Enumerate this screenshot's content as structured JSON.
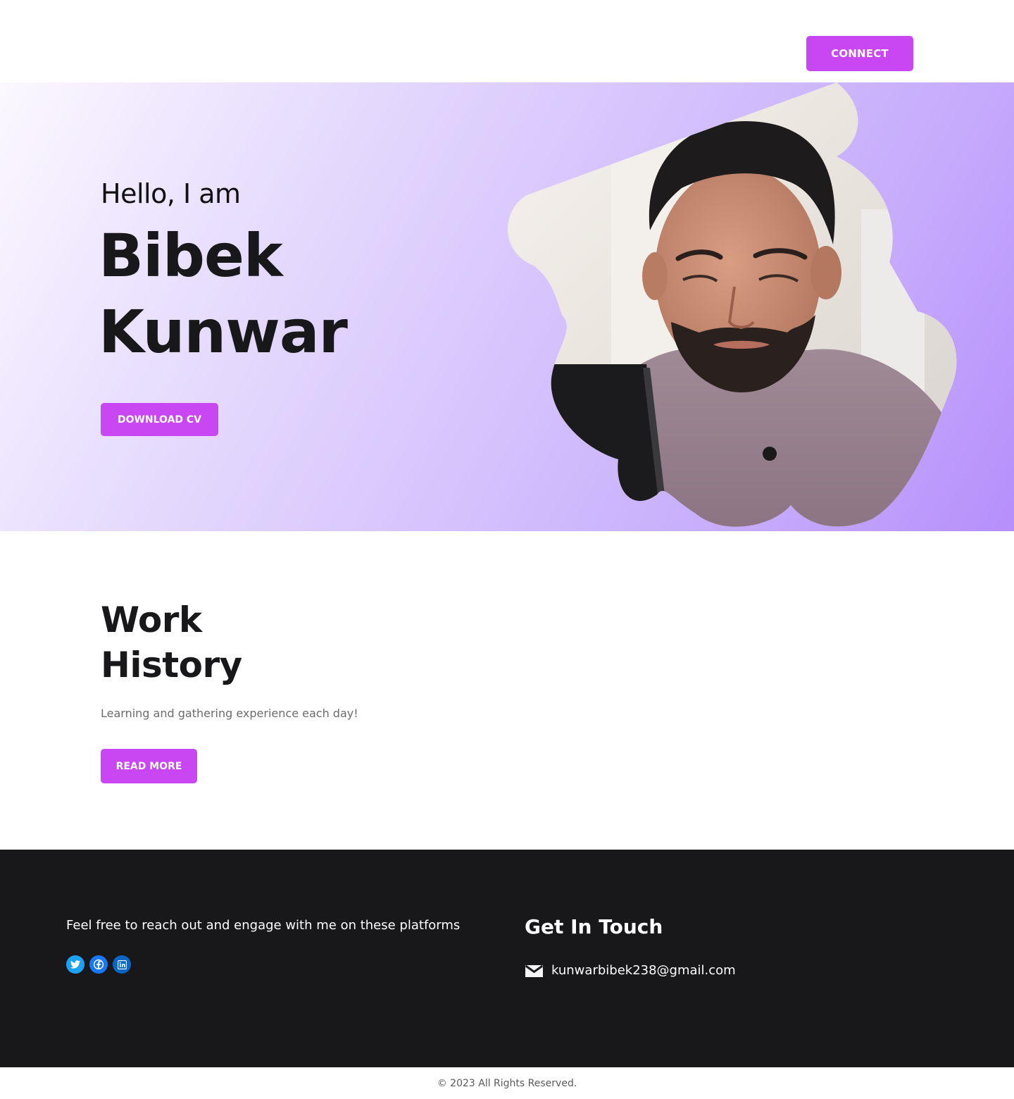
{
  "header": {
    "connect_label": "CONNECT"
  },
  "hero": {
    "greeting": "Hello, I am",
    "name_first": "Bibek",
    "name_last": "Kunwar",
    "download_label": "DOWNLOAD CV",
    "photo_icon": "portrait-photo"
  },
  "work": {
    "title_line1": "Work",
    "title_line2": "History",
    "subtitle": "Learning and gathering experience each day!",
    "read_more_label": "READ MORE"
  },
  "footer": {
    "tagline": "Feel free to reach out and engage with me on these platforms",
    "socials": [
      {
        "icon": "twitter-icon",
        "color": "#1da1f2"
      },
      {
        "icon": "facebook-icon",
        "color": "#1877f2"
      },
      {
        "icon": "linkedin-icon",
        "color": "#0a66c2"
      }
    ],
    "contact_title": "Get In Touch",
    "email": "kunwarbibek238@gmail.com",
    "email_icon": "mail-icon",
    "copyright": "© 2023 All Rights Reserved."
  },
  "colors": {
    "accent": "#c847f2",
    "dark": "#18181b",
    "hero_gradient_start": "#fbf8ff",
    "hero_gradient_end": "#b68ffb"
  }
}
